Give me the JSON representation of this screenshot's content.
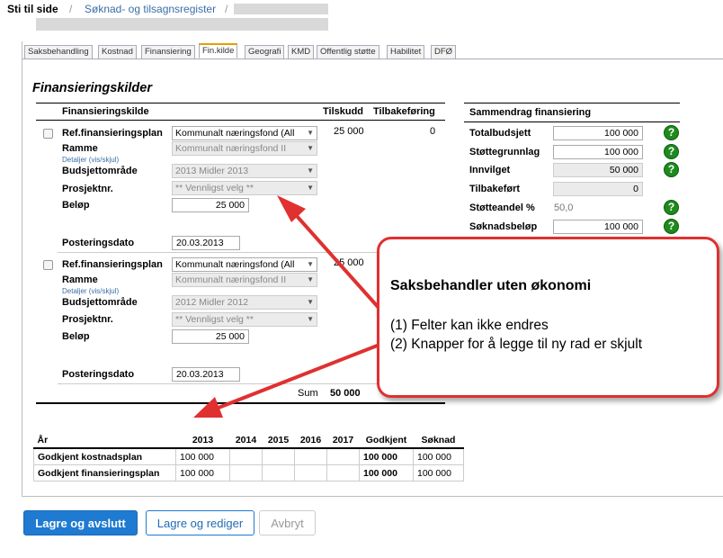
{
  "breadcrumb": {
    "lead": "Sti til side",
    "link": "Søknad- og tilsagnsregister",
    "separator": "/"
  },
  "tabs": [
    "Saksbehandling",
    "Kostnad",
    "Finansiering",
    "Fin.kilde",
    "Geografi",
    "KMD",
    "Offentlig støtte",
    "Habilitet",
    "DFØ"
  ],
  "active_tab": "Fin.kilde",
  "section_title": "Finansieringskilder",
  "columns": {
    "source": "Finansieringskilde",
    "grant": "Tilskudd",
    "refund": "Tilbakeføring"
  },
  "rows": [
    {
      "labels": {
        "ref": "Ref.finansieringsplan",
        "frame": "Ramme",
        "details": "Detaljer (vis/skjul)",
        "budget": "Budsjettområde",
        "project": "Prosjektnr.",
        "amount": "Beløp",
        "posting": "Posteringsdato"
      },
      "ref_value": "Kommunalt næringsfond (All",
      "frame_value": "Kommunalt næringsfond II",
      "budget_value": "2013 Midler 2013",
      "project_value": "** Vennligst velg **",
      "amount_value": "25 000",
      "posting_value": "20.03.2013",
      "grant": "25 000",
      "refund": "0"
    },
    {
      "labels": {
        "ref": "Ref.finansieringsplan",
        "frame": "Ramme",
        "details": "Detaljer (vis/skjul)",
        "budget": "Budsjettområde",
        "project": "Prosjektnr.",
        "amount": "Beløp",
        "posting": "Posteringsdato"
      },
      "ref_value": "Kommunalt næringsfond (All",
      "frame_value": "Kommunalt næringsfond II",
      "budget_value": "2012 Midler 2012",
      "project_value": "** Vennligst velg **",
      "amount_value": "25 000",
      "posting_value": "20.03.2013",
      "grant": "25 000"
    }
  ],
  "sum": {
    "label": "Sum",
    "value": "50 000"
  },
  "summary": {
    "title": "Sammendrag finansiering",
    "items": [
      {
        "label": "Totalbudsjett",
        "value": "100 000",
        "style": "input"
      },
      {
        "label": "Støttegrunnlag",
        "value": "100 000",
        "style": "input"
      },
      {
        "label": "Innvilget",
        "value": "50 000",
        "style": "readonly"
      },
      {
        "label": "Tilbakeført",
        "value": "0",
        "style": "readonly"
      },
      {
        "label": "Støtteandel %",
        "value": "50,0",
        "style": "text"
      },
      {
        "label": "Søknadsbeløp",
        "value": "100 000",
        "style": "input"
      }
    ]
  },
  "year_table": {
    "headers": [
      "År",
      "2013",
      "2014",
      "2015",
      "2016",
      "2017",
      "Godkjent",
      "Søknad"
    ],
    "rows": [
      {
        "label": "Godkjent kostnadsplan",
        "cells": [
          "100 000",
          "",
          "",
          "",
          "",
          "100 000",
          "100 000"
        ]
      },
      {
        "label": "Godkjent finansieringsplan",
        "cells": [
          "100 000",
          "",
          "",
          "",
          "",
          "100 000",
          "100 000"
        ]
      }
    ]
  },
  "buttons": {
    "save_close": "Lagre og avslutt",
    "save_edit": "Lagre og rediger",
    "cancel": "Avbryt"
  },
  "callout": {
    "title": "Saksbehandler uten økonomi",
    "line1": "(1) Felter kan ikke endres",
    "line2": "(2) Knapper for å legge til ny rad er skjult"
  },
  "colors": {
    "arrow": "#e03030",
    "help": "#1e8a1e",
    "primary": "#1f7ad1"
  }
}
